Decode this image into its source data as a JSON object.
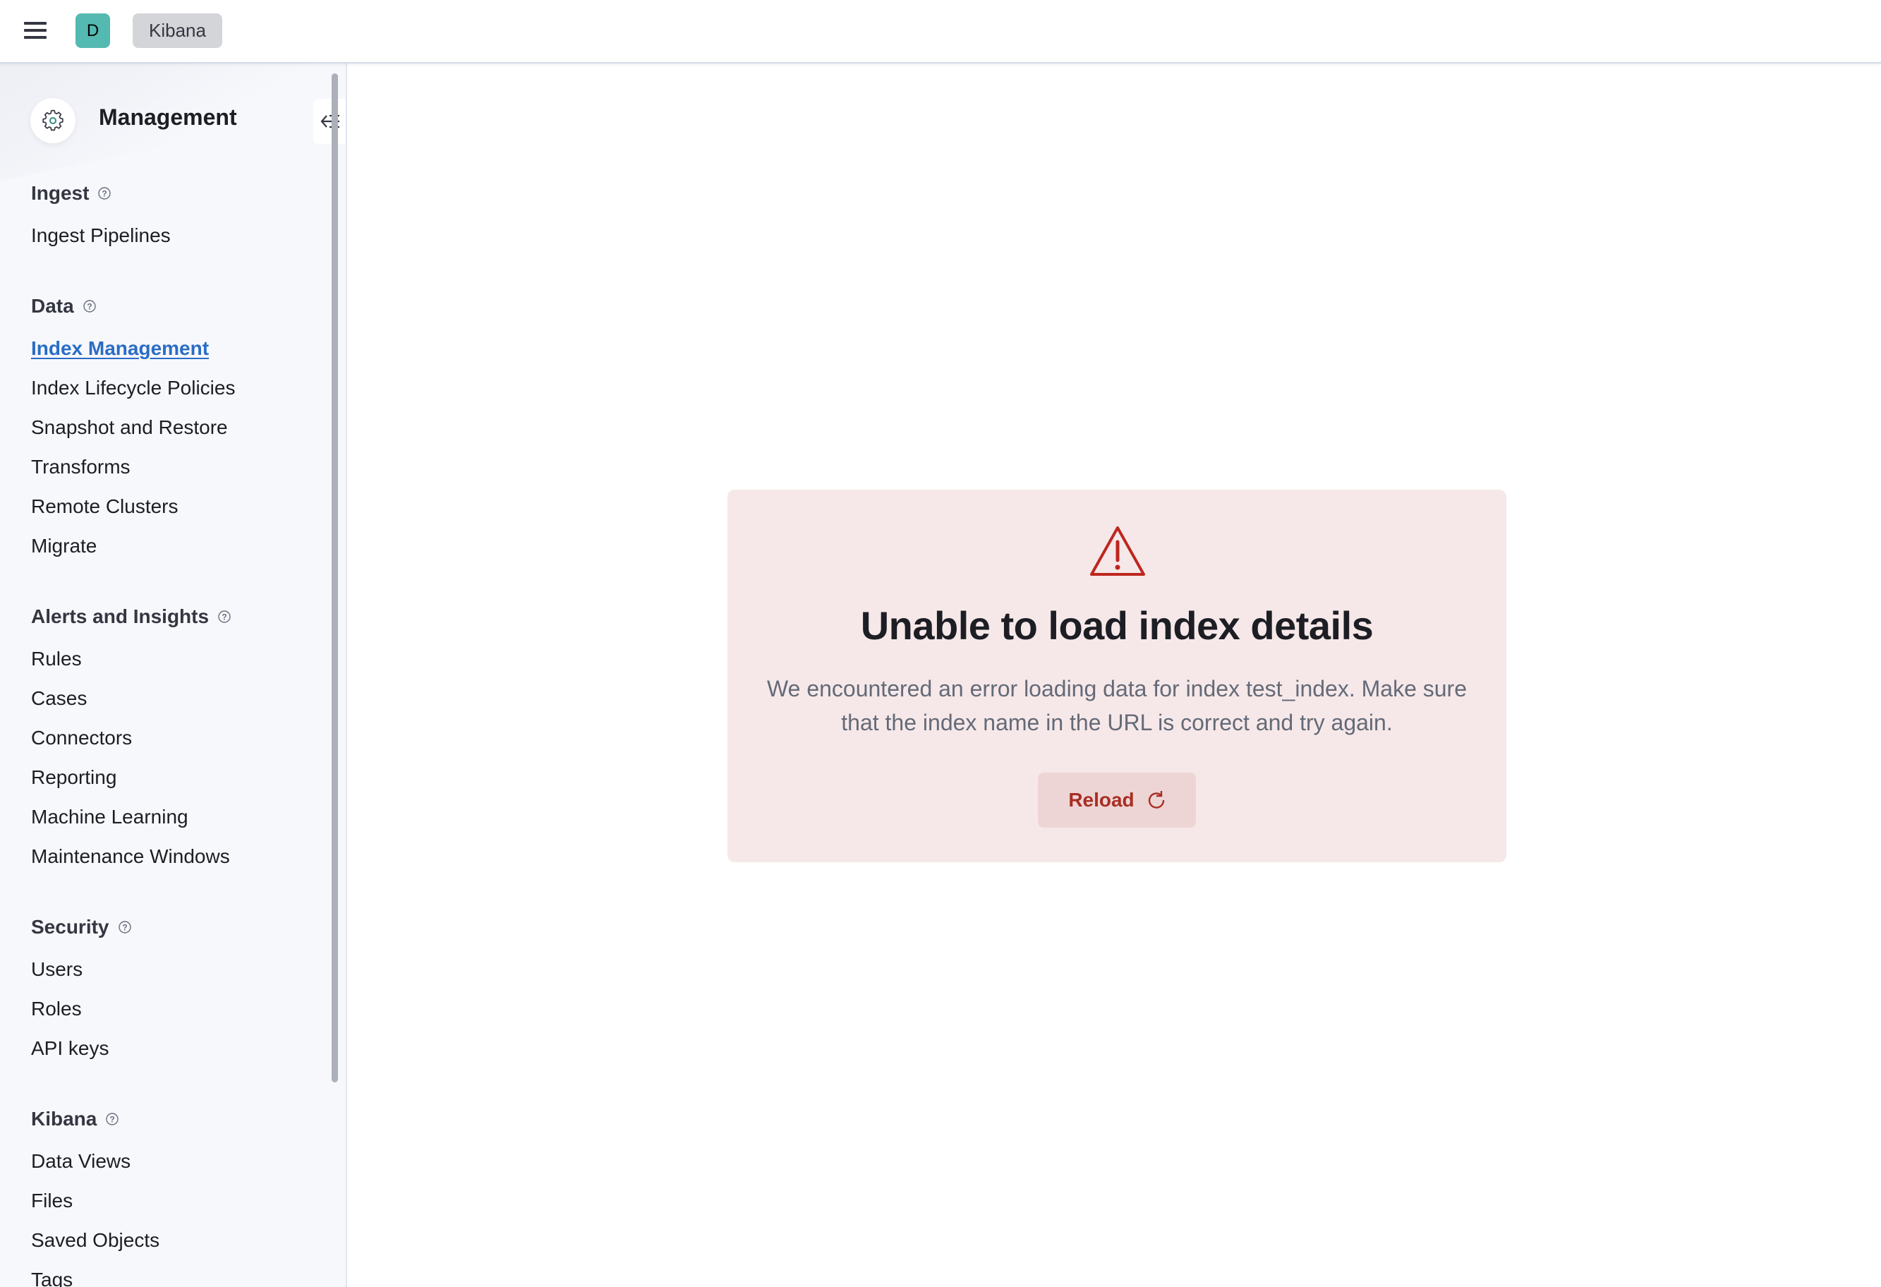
{
  "header": {
    "menu_icon": "hamburger-menu-icon",
    "avatar_letter": "D",
    "breadcrumb": "Kibana"
  },
  "sidebar": {
    "title": "Management",
    "title_icon": "gear-icon",
    "collapse_icon": "collapse-sidebar-icon",
    "sections": [
      {
        "title": "Ingest",
        "items": [
          "Ingest Pipelines"
        ]
      },
      {
        "title": "Data",
        "items": [
          "Index Management",
          "Index Lifecycle Policies",
          "Snapshot and Restore",
          "Transforms",
          "Remote Clusters",
          "Migrate"
        ]
      },
      {
        "title": "Alerts and Insights",
        "items": [
          "Rules",
          "Cases",
          "Connectors",
          "Reporting",
          "Machine Learning",
          "Maintenance Windows"
        ]
      },
      {
        "title": "Security",
        "items": [
          "Users",
          "Roles",
          "API keys"
        ]
      },
      {
        "title": "Kibana",
        "items": [
          "Data Views",
          "Files",
          "Saved Objects",
          "Tags"
        ]
      }
    ],
    "active_item": "Index Management"
  },
  "error": {
    "icon": "warning-icon",
    "title": "Unable to load index details",
    "body": "We encountered an error loading data for index test_index. Make sure that the index name in the URL is correct and try again.",
    "button_label": "Reload",
    "button_icon": "refresh-icon"
  },
  "colors": {
    "accent": "#2a6dc5",
    "danger": "#a82e23",
    "avatar": "#54b9b1",
    "error_panel_bg": "#f6e8e9"
  }
}
